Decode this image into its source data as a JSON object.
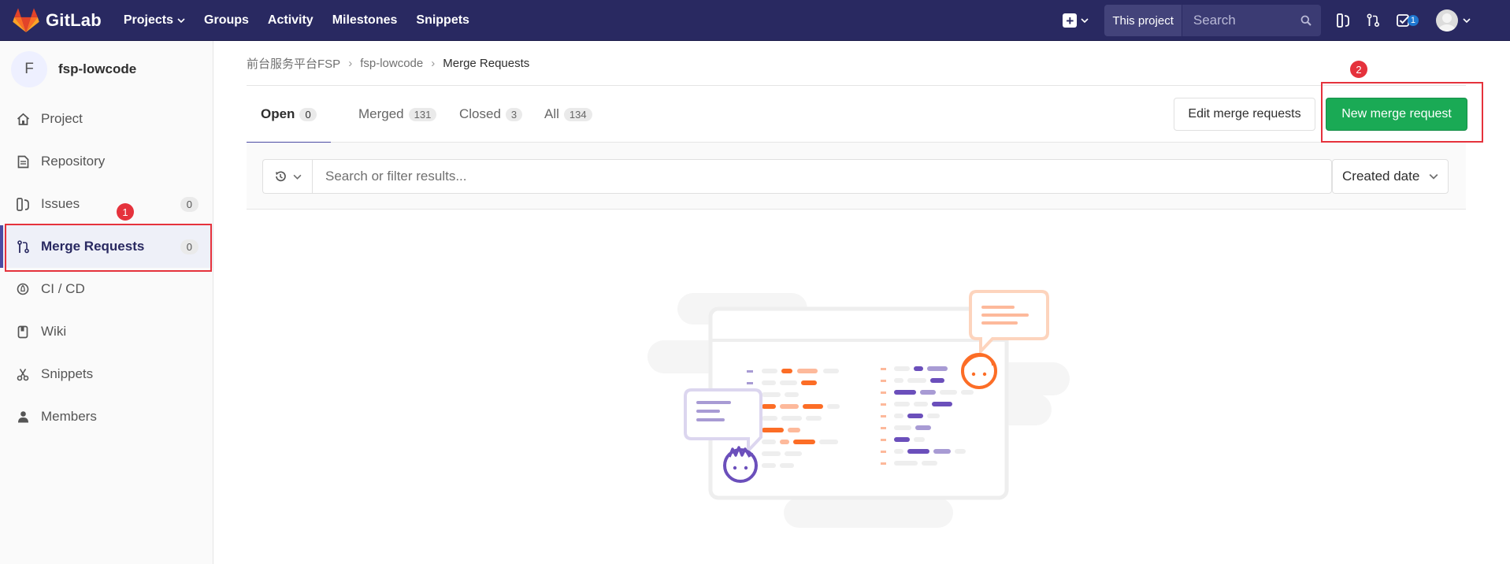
{
  "navbar": {
    "brand": "GitLab",
    "links": [
      {
        "label": "Projects",
        "dropdown": true
      },
      {
        "label": "Groups"
      },
      {
        "label": "Activity"
      },
      {
        "label": "Milestones"
      },
      {
        "label": "Snippets"
      }
    ],
    "search_scope": "This project",
    "search_placeholder": "Search",
    "todo_count": "1"
  },
  "sidebar": {
    "project_initial": "F",
    "project_name": "fsp-lowcode",
    "items": [
      {
        "label": "Project",
        "icon": "home-icon"
      },
      {
        "label": "Repository",
        "icon": "document-icon"
      },
      {
        "label": "Issues",
        "icon": "issues-icon",
        "count": "0"
      },
      {
        "label": "Merge Requests",
        "icon": "merge-request-icon",
        "count": "0",
        "active": true
      },
      {
        "label": "CI / CD",
        "icon": "rocket-icon"
      },
      {
        "label": "Wiki",
        "icon": "book-icon"
      },
      {
        "label": "Snippets",
        "icon": "scissors-icon"
      },
      {
        "label": "Members",
        "icon": "user-icon"
      }
    ]
  },
  "breadcrumb": [
    "前台服务平台FSP",
    "fsp-lowcode",
    "Merge Requests"
  ],
  "tabs": [
    {
      "label": "Open",
      "count": "0",
      "active": true
    },
    {
      "label": "Merged",
      "count": "131"
    },
    {
      "label": "Closed",
      "count": "3"
    },
    {
      "label": "All",
      "count": "134"
    }
  ],
  "buttons": {
    "edit": "Edit merge requests",
    "new": "New merge request"
  },
  "filter": {
    "placeholder": "Search or filter results...",
    "sort": "Created date"
  },
  "annotations": {
    "marker_1": "1",
    "marker_2": "2"
  },
  "colors": {
    "navbar": "#292961",
    "primary_button": "#1aaa55",
    "annotation_red": "#e5323c",
    "illustration_orange": "#fc6d26",
    "illustration_purple": "#6b4fbb"
  }
}
